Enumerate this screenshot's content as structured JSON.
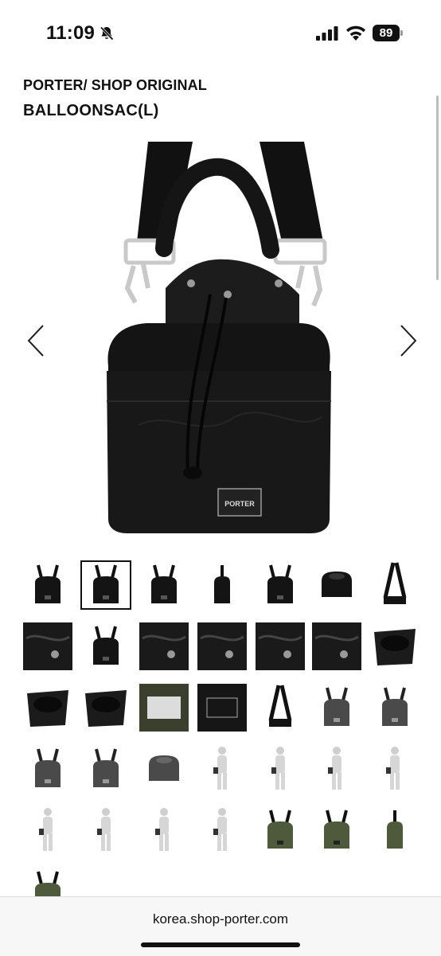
{
  "status_bar": {
    "time": "11:09",
    "battery_level": "89",
    "icons": [
      "bell-slash-icon",
      "cellular-signal-icon",
      "wifi-icon",
      "battery-icon"
    ]
  },
  "product": {
    "brand": "PORTER/ SHOP ORIGINAL",
    "name": "BALLOONSAC(L)",
    "bag_label": "PORTER"
  },
  "gallery": {
    "prev_icon": "chevron-left-icon",
    "next_icon": "chevron-right-icon",
    "selected_index": 1,
    "thumbnails": [
      {
        "kind": "bag-black"
      },
      {
        "kind": "bag-black"
      },
      {
        "kind": "bag-black"
      },
      {
        "kind": "bag-side"
      },
      {
        "kind": "bag-black"
      },
      {
        "kind": "bag-top"
      },
      {
        "kind": "strap"
      },
      {
        "kind": "detail"
      },
      {
        "kind": "bag-black"
      },
      {
        "kind": "detail"
      },
      {
        "kind": "detail"
      },
      {
        "kind": "detail"
      },
      {
        "kind": "detail"
      },
      {
        "kind": "interior"
      },
      {
        "kind": "interior"
      },
      {
        "kind": "interior"
      },
      {
        "kind": "label-olive"
      },
      {
        "kind": "label-black"
      },
      {
        "kind": "strap"
      },
      {
        "kind": "bag-gray"
      },
      {
        "kind": "bag-gray"
      },
      {
        "kind": "bag-gray"
      },
      {
        "kind": "bag-gray"
      },
      {
        "kind": "bag-top-gray"
      },
      {
        "kind": "model"
      },
      {
        "kind": "model"
      },
      {
        "kind": "model"
      },
      {
        "kind": "model"
      },
      {
        "kind": "model"
      },
      {
        "kind": "model"
      },
      {
        "kind": "model"
      },
      {
        "kind": "model"
      },
      {
        "kind": "bag-olive"
      },
      {
        "kind": "bag-olive"
      },
      {
        "kind": "bag-olive-side"
      },
      {
        "kind": "bag-olive"
      }
    ]
  },
  "browser": {
    "url": "korea.shop-porter.com"
  },
  "colors": {
    "bag_black": "#141414",
    "bag_gray": "#4a4a4a",
    "bag_olive": "#4f5a3c",
    "hardware": "#c9c9c9"
  }
}
